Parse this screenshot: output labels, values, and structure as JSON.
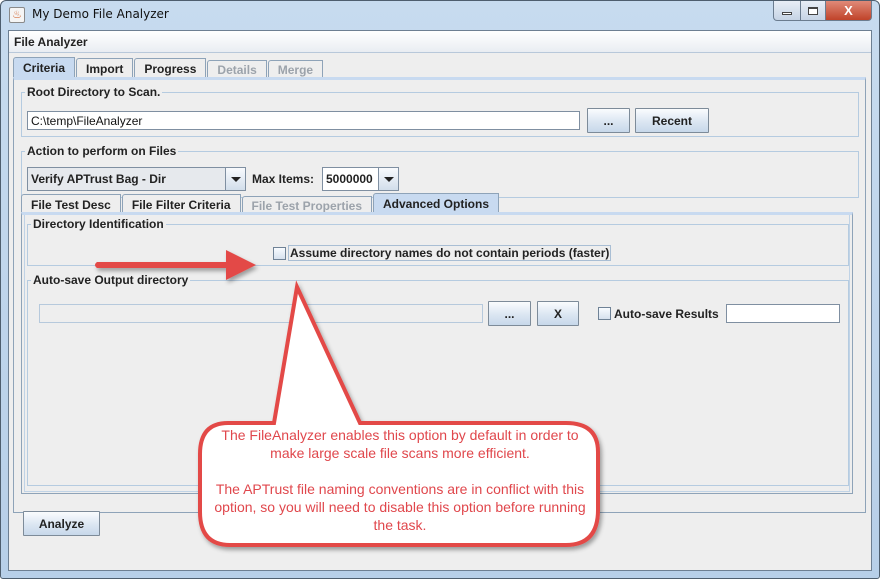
{
  "window": {
    "title": "My Demo File Analyzer",
    "icon": "java-app-icon",
    "controls": {
      "minimize": "minimize",
      "maximize": "maximize",
      "close": "X"
    }
  },
  "frame": {
    "title": "File Analyzer"
  },
  "main_tabs": [
    {
      "label": "Criteria",
      "state": "active"
    },
    {
      "label": "Import",
      "state": "enabled"
    },
    {
      "label": "Progress",
      "state": "enabled"
    },
    {
      "label": "Details",
      "state": "disabled"
    },
    {
      "label": "Merge",
      "state": "disabled"
    }
  ],
  "root_directory": {
    "legend": "Root Directory to Scan.",
    "value": "C:\\temp\\FileAnalyzer",
    "browse_label": "...",
    "recent_label": "Recent"
  },
  "action": {
    "legend": "Action to perform on Files",
    "selected": "Verify APTrust Bag - Dir",
    "max_items_label": "Max Items:",
    "max_items_value": "5000000"
  },
  "inner_tabs": [
    {
      "label": "File Test Desc",
      "state": "enabled"
    },
    {
      "label": "File Filter Criteria",
      "state": "enabled"
    },
    {
      "label": "File Test Properties",
      "state": "disabled"
    },
    {
      "label": "Advanced Options",
      "state": "active"
    }
  ],
  "directory_identification": {
    "legend": "Directory Identification",
    "checkbox_label": "Assume directory names do not contain periods (faster)",
    "checked": false
  },
  "autosave": {
    "legend": "Auto-save Output directory",
    "path_value": "",
    "browse_label": "...",
    "clear_label": "X",
    "checkbox_label": "Auto-save Results",
    "checked": false,
    "results_value": ""
  },
  "analyze_label": "Analyze",
  "annotation": {
    "color": "#e34a47",
    "paragraphs": [
      "The FileAnalyzer enables this option by default in order to make large scale file scans more efficient.",
      "The APTrust file naming conventions are in conflict with this option, so you will need to disable this option before running the task."
    ]
  }
}
